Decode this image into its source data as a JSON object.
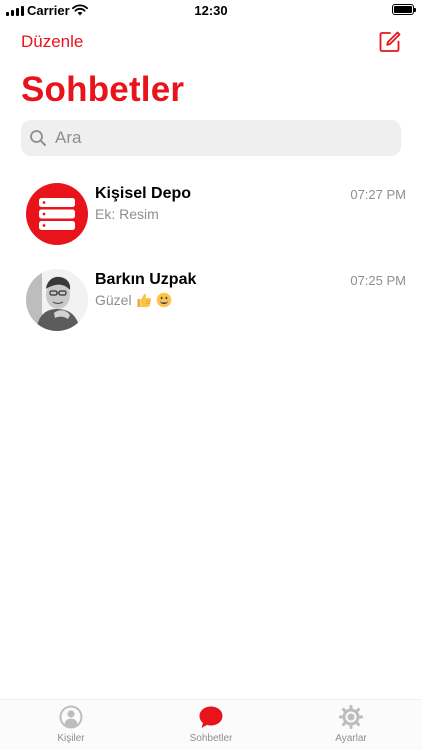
{
  "status_bar": {
    "carrier": "Carrier",
    "time": "12:30"
  },
  "nav": {
    "edit_label": "Düzenle",
    "title": "Sohbetler"
  },
  "search": {
    "placeholder": "Ara"
  },
  "chats": [
    {
      "name": "Kişisel Depo",
      "preview": "Ek: Resim",
      "time": "07:27 PM",
      "avatar": "storage-icon"
    },
    {
      "name": "Barkın Uzpak",
      "preview": "Güzel",
      "preview_emojis": [
        "thumbs-up-emoji",
        "grinning-face-emoji"
      ],
      "time": "07:25 PM",
      "avatar": "profile-photo"
    }
  ],
  "tabs": [
    {
      "label": "Kişiler",
      "icon": "contacts-icon",
      "active": false
    },
    {
      "label": "Sohbetler",
      "icon": "chat-bubble-icon",
      "active": true
    },
    {
      "label": "Ayarlar",
      "icon": "gear-icon",
      "active": false
    }
  ],
  "colors": {
    "accent": "#e8131b",
    "secondary_text": "#8e8e93",
    "search_background": "#efeff0",
    "tab_inactive": "#bdbdbd"
  }
}
